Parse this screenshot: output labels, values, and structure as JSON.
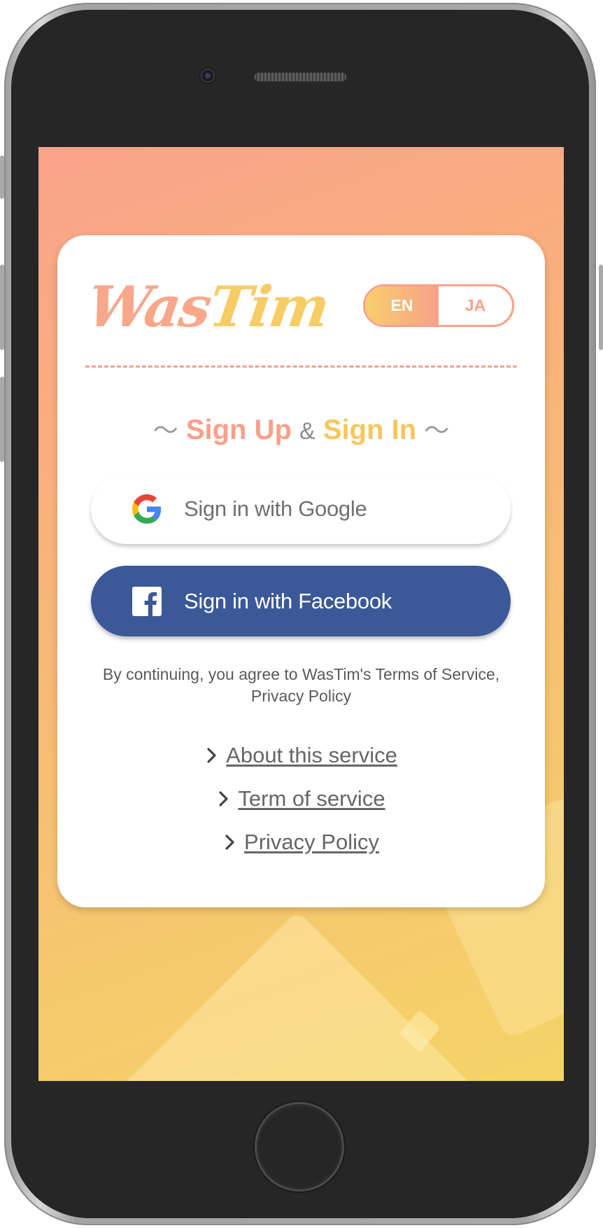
{
  "app": {
    "logo_part1": "Was",
    "logo_part2": "Tim"
  },
  "language": {
    "options": [
      "EN",
      "JA"
    ],
    "selected": "EN"
  },
  "auth": {
    "title_tilde_left": "〜",
    "title_signup": "Sign Up",
    "title_amp": "&",
    "title_signin": "Sign In",
    "title_tilde_right": "〜",
    "google_label": "Sign in with Google",
    "facebook_label": "Sign in with Facebook",
    "terms_line1": "By continuing, you agree to WasTim's Terms of Service,",
    "terms_line2": "Privacy Policy"
  },
  "links": [
    {
      "label": "About this service"
    },
    {
      "label": "Term of service"
    },
    {
      "label": "Privacy Policy"
    }
  ],
  "colors": {
    "brand_coral": "#f9a08a",
    "brand_yellow": "#f7c65c",
    "facebook_blue": "#3b5998",
    "link_gray": "#666666"
  },
  "icons": {
    "google": "google-g-icon",
    "facebook": "facebook-f-icon",
    "chevron": "chevron-right-icon"
  }
}
